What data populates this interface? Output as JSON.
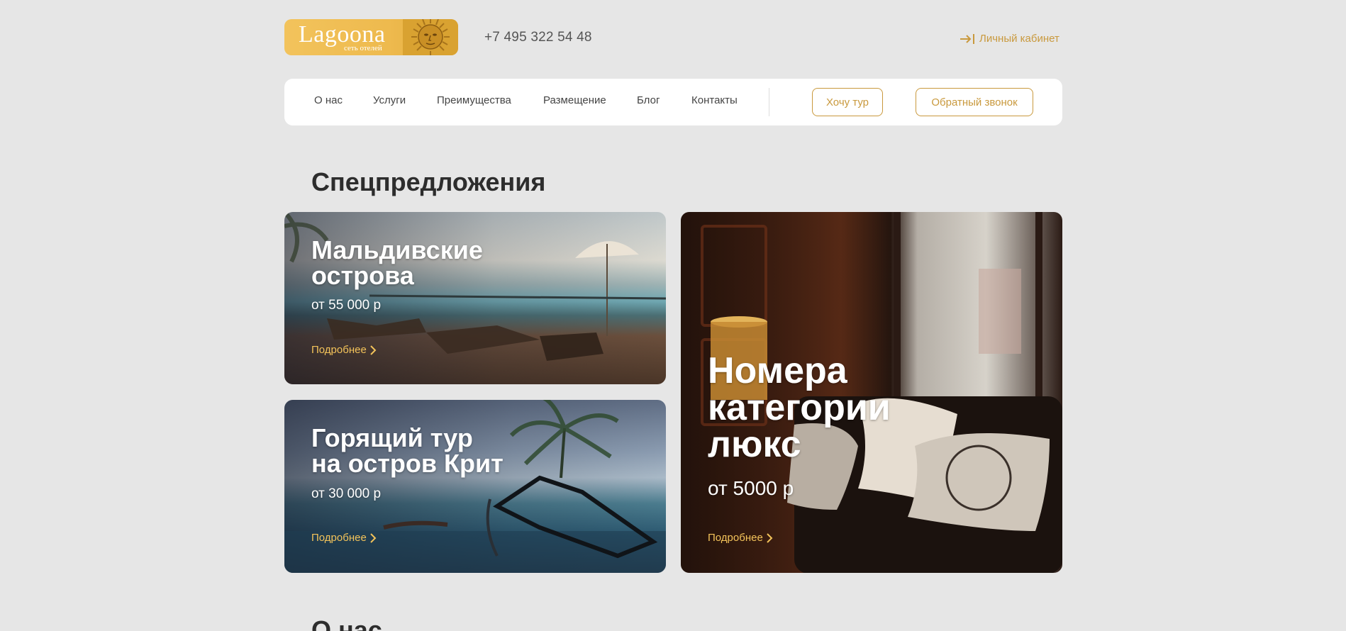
{
  "header": {
    "logo_name": "Lagoona",
    "logo_tagline": "сеть отелей",
    "phone": "+7 495 322 54 48",
    "cabinet_label": "Личный кабинет",
    "cabinet_icon": "login-arrow-icon"
  },
  "nav": {
    "items": [
      {
        "label": "О нас"
      },
      {
        "label": "Услуги"
      },
      {
        "label": "Преимущества"
      },
      {
        "label": "Размещение"
      },
      {
        "label": "Блог"
      },
      {
        "label": "Контакты"
      }
    ],
    "tour_button": "Хочу тур",
    "callback_button": "Обратный звонок"
  },
  "offers": {
    "title": "Спецпредложения",
    "cards": [
      {
        "title_line1": "Мальдивские",
        "title_line2": "острова",
        "price": "от 55 000 р",
        "more": "Подробнее"
      },
      {
        "title_line1": "Горящий тур",
        "title_line2": "на остров Крит",
        "price": "от 30 000 р",
        "more": "Подробнее"
      },
      {
        "title_line1": "Номера",
        "title_line2": "категории",
        "title_line3": "люкс",
        "price": "от 5000 р",
        "more": "Подробнее"
      }
    ]
  },
  "about": {
    "title": "О нас"
  },
  "colors": {
    "accent": "#c9993d",
    "link_yellow": "#f3c35a",
    "background": "#e6e6e6"
  }
}
